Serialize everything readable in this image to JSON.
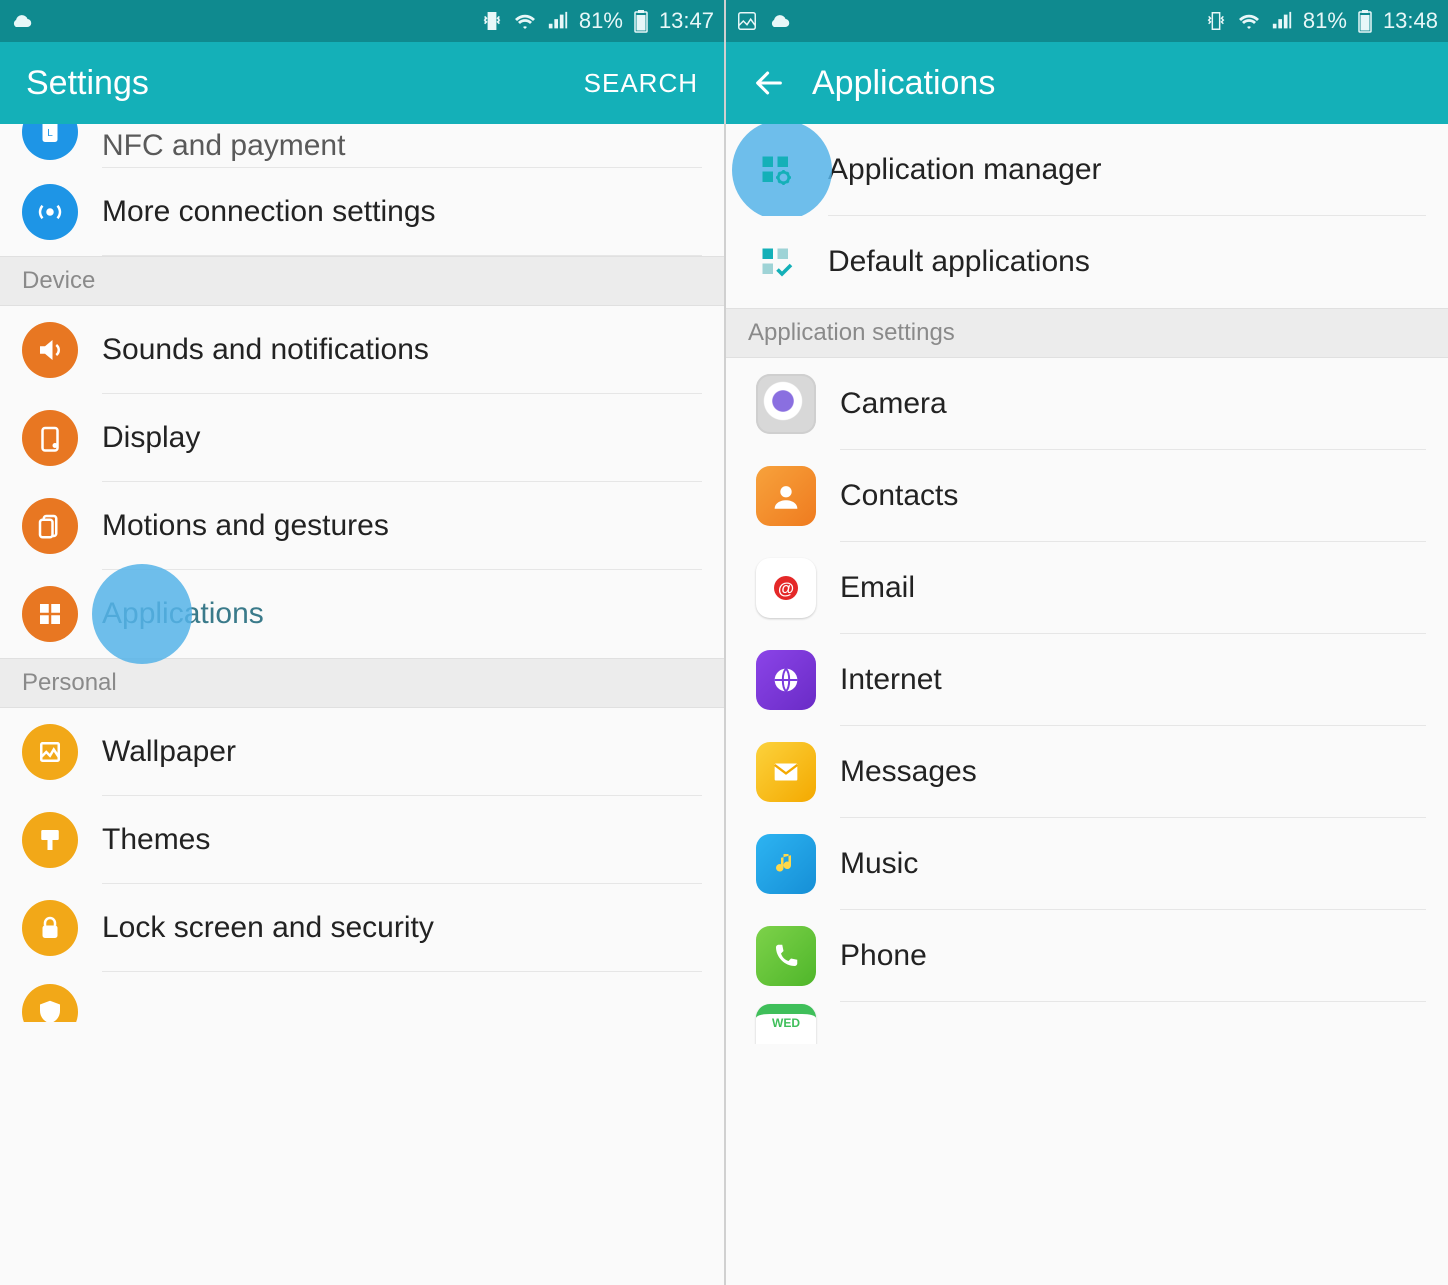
{
  "left": {
    "status": {
      "battery": "81%",
      "time": "13:47"
    },
    "appbar": {
      "title": "Settings",
      "search": "SEARCH"
    },
    "rows_top": [
      {
        "id": "nfc",
        "label": "NFC and payment",
        "icon": "nfc",
        "bg": "bg-blue",
        "cut": true
      },
      {
        "id": "more-conn",
        "label": "More connection settings",
        "icon": "more-conn",
        "bg": "bg-blue"
      }
    ],
    "section_device": "Device",
    "rows_device": [
      {
        "id": "sounds",
        "label": "Sounds and notifications",
        "icon": "sound",
        "bg": "bg-orange"
      },
      {
        "id": "display",
        "label": "Display",
        "icon": "display",
        "bg": "bg-orange"
      },
      {
        "id": "motions",
        "label": "Motions and gestures",
        "icon": "motions",
        "bg": "bg-orange"
      },
      {
        "id": "applications",
        "label": "Applications",
        "icon": "apps",
        "bg": "bg-orange",
        "touch": true
      }
    ],
    "section_personal": "Personal",
    "rows_personal": [
      {
        "id": "wallpaper",
        "label": "Wallpaper",
        "icon": "wallpaper",
        "bg": "bg-amber"
      },
      {
        "id": "themes",
        "label": "Themes",
        "icon": "themes",
        "bg": "bg-amber"
      },
      {
        "id": "lock",
        "label": "Lock screen and security",
        "icon": "lock",
        "bg": "bg-amber"
      },
      {
        "id": "privacy",
        "label": "",
        "icon": "privacy",
        "bg": "bg-amber",
        "partial": true
      }
    ]
  },
  "right": {
    "status": {
      "battery": "81%",
      "time": "13:48"
    },
    "appbar": {
      "title": "Applications"
    },
    "rows_top": [
      {
        "id": "app-manager",
        "label": "Application manager",
        "icon": "app-manager",
        "touch": true
      },
      {
        "id": "default-apps",
        "label": "Default applications",
        "icon": "default-apps"
      }
    ],
    "section_app": "Application settings",
    "apps": [
      {
        "id": "camera",
        "label": "Camera",
        "color": "#dcdcdc"
      },
      {
        "id": "contacts",
        "label": "Contacts",
        "color": "#f28c1e"
      },
      {
        "id": "email",
        "label": "Email",
        "color": "#ffffff"
      },
      {
        "id": "internet",
        "label": "Internet",
        "color": "#7a3bdc"
      },
      {
        "id": "messages",
        "label": "Messages",
        "color": "#f5b400"
      },
      {
        "id": "music",
        "label": "Music",
        "color": "#1ea0ea"
      },
      {
        "id": "phone",
        "label": "Phone",
        "color": "#5fbf3c"
      },
      {
        "id": "calendar",
        "label": "",
        "color": "#ffffff",
        "partial": true,
        "badge": "WED"
      }
    ]
  }
}
